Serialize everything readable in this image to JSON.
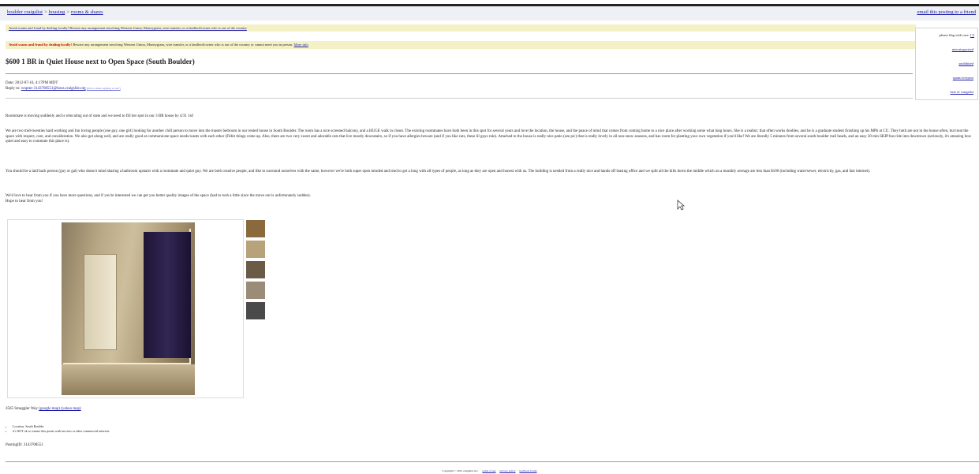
{
  "topbar": {
    "crumbs": [
      "boulder craigslist",
      "housing",
      "rooms & shares"
    ],
    "email_friend": "email this posting to a friend"
  },
  "notice1": {
    "link": "Avoid scams and fraud by dealing locally! Beware any arrangement involving Western Union, Moneygram, wire transfer, or a landlord/owner who is out of the country"
  },
  "notice2": {
    "warning": "Avoid scams and fraud by dealing locally!",
    "text": "Beware any arrangement involving Western Union, Moneygram, wire transfer, or a landlord/owner who is out of the country or cannot meet you in person.",
    "more_link": "More info"
  },
  "flagbox": {
    "heading": "please flag with care:",
    "help": "[?]",
    "flags": [
      "miscategorized",
      "prohibited",
      "spam/overpost",
      "best of craigslist"
    ]
  },
  "post": {
    "title": "$600 1 BR in Quiet House next to Open Space (South Boulder)",
    "date": "Date: 2012-07-16, 4:17PM MDT",
    "reply_label": "Reply to:",
    "reply_email": "wnpmr-3143708551@hous.craigslist.org",
    "reply_note": "[Errors when replying to ads?]"
  },
  "paragraphs": [
    "Roommate is moving suddenly and is relocating out of state and we need to fill her spot in our 3 BR house by 4/31 1st!",
    "We are two mid-twenties hard working and fun loving people (one guy, one girl) looking for another chill person to move into the master bedroom in our rented house in South Boulder. The room has a nice screened balcony, and a HUGE walk in closet. The existing roommates have both been in this spot for several years and love the location, the house, and the peace of mind that comes from coming home to a nice place after working some what long hours. She is a realtor; that often works doubles, and he is a graduate student finishing up his MPh at CU. They both are not in the house often, but treat the space with respect, care, and consideration. We also get along well, and are really good at communicate space needs/wants with each other (Fitbit things come up. Also, there are two very sweet and adorable cats that live mostly downstairs, so if you have allergies beware (and if you like cats, these lil guys rule). Attached to the house is really nice patio (see pic) that is really lovely in all non-snow seasons, and has room for planting your own vegetation if you'd like! We are literally 5 minutes from several south boulder trail heads, and an easy 20 min SKIP bus ride into downtown (seriously, it's amazing how quiet and easy to commute this place is).",
    "You should be a laid back person (guy or gal) who doesn't mind sharing a bathroom upstairs with a roommate and quiet guy. We are both creative people, and like to surround ourselves with the same, however we're both super open minded and tend to get a long with all types of people, as long as they are open and honest with us. The building is nestled from a really nice and hands off leasing office and we split all the bills down the middle which on a monthly average are less than $100 (including water/sewer, electricity, gas, and fast internet).",
    "We'd love to hear from you if you have more questions, and if you're interested we can get you better quality images of the space (had to rush a little since the move out is unfortunately sudden).",
    "Hope to hear from you!"
  ],
  "map_line": {
    "label": "3565 Smuggler Way",
    "link": "(google map) (yahoo map)"
  },
  "bullets": [
    "Location: South Boulder",
    "it's NOT ok to contact this poster with services or other commercial interests"
  ],
  "posting_id": "PostingID: 3143708551",
  "footer": {
    "copyright": "Copyright © 2012 craigslist, inc.",
    "links": [
      "terms of use",
      "privacy policy",
      "feedback forum"
    ]
  },
  "thumb_colors": [
    "#8a6a3c",
    "#b8a27a",
    "#6a5a46",
    "#9a8c78",
    "#4a4a4a"
  ]
}
